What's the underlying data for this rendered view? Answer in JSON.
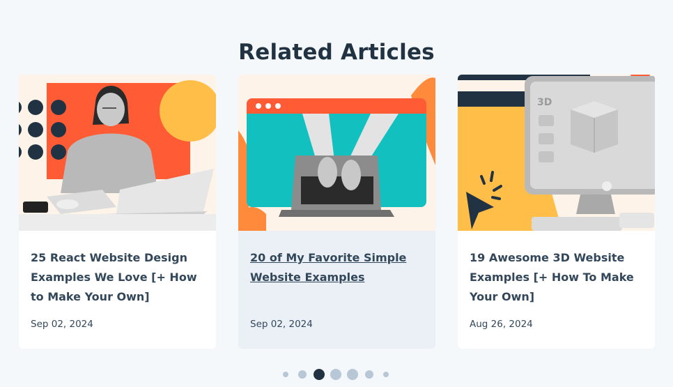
{
  "section": {
    "title": "Related Articles"
  },
  "articles": [
    {
      "title": "25 React Website Design Examples We Love [+ How to Make Your Own]",
      "date": "Sep 02, 2024",
      "image": "woman-with-laptop-illustration",
      "active": false
    },
    {
      "title": "20 of My Favorite Simple Website Examples",
      "date": "Sep 02, 2024",
      "image": "hands-typing-laptop-browser-illustration",
      "active": true
    },
    {
      "title": "19 Awesome 3D Website Examples [+ How To Make Your Own]",
      "date": "Aug 26, 2024",
      "image": "3d-monitor-cursor-illustration",
      "active": false
    }
  ],
  "carousel": {
    "total_dots": 7,
    "active_index": 2
  },
  "colors": {
    "background": "#f5f8fa",
    "text": "#213343",
    "accent_orange": "#ff5c35",
    "accent_yellow": "#ffbe48",
    "accent_teal": "#12c0c0",
    "cream": "#fdf3e9"
  }
}
